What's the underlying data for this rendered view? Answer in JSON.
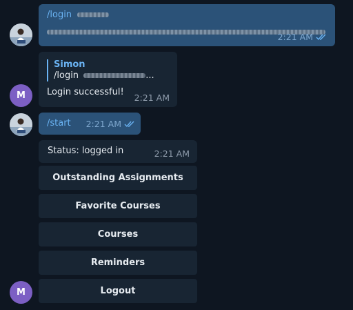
{
  "messages": [
    {
      "direction": "outgoing",
      "command": "/login",
      "time": "2:21 AM",
      "status_icon": "double-check-icon"
    },
    {
      "direction": "incoming",
      "reply_to_name": "Simon",
      "reply_to_text": "/login",
      "reply_ellipsis": "...",
      "text": "Login successful!",
      "time": "2:21 AM",
      "avatar_letter": "M"
    },
    {
      "direction": "outgoing",
      "command": "/start",
      "time": "2:21 AM",
      "status_icon": "double-check-icon"
    },
    {
      "direction": "incoming",
      "text": "Status: logged in",
      "time": "2:21 AM",
      "avatar_letter": "M"
    }
  ],
  "keyboard": {
    "buttons": [
      "Outstanding Assignments",
      "Favorite Courses",
      "Courses",
      "Reminders",
      "Logout"
    ]
  },
  "colors": {
    "background": "#0e1621",
    "outgoing_bubble": "#2b5278",
    "incoming_bubble": "#182533",
    "accent": "#6ab3f3",
    "avatar_letter_bg": "#7c5fc4"
  }
}
